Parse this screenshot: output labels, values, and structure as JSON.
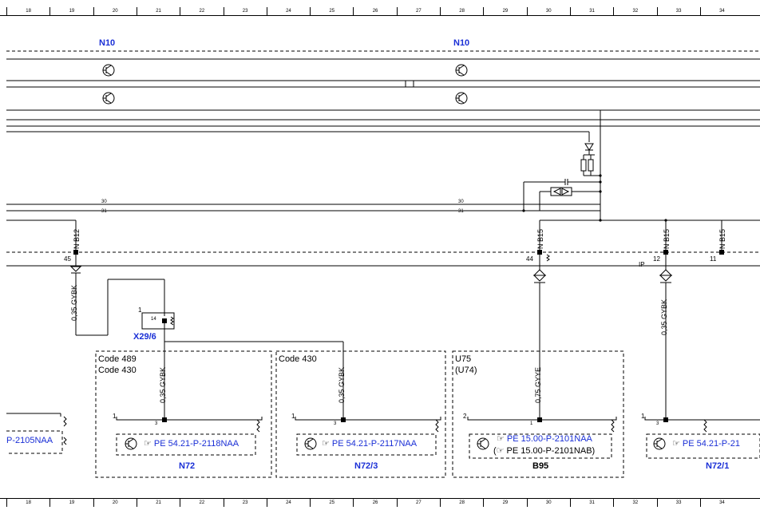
{
  "ruler": [
    "18",
    "19",
    "20",
    "21",
    "22",
    "23",
    "24",
    "25",
    "26",
    "27",
    "28",
    "29",
    "30",
    "31",
    "32",
    "33",
    "34"
  ],
  "components": {
    "n10_left": "N10",
    "n10_right": "N10",
    "x29": "X29/6",
    "n72": "N72",
    "n72_3": "N72/3",
    "b95": "B95",
    "n72_1": "N72/1",
    "u75": "U75",
    "u74": "(U74)"
  },
  "codes": {
    "box1_line1": "Code 489",
    "box1_line2": "Code 430",
    "box2": "Code 430"
  },
  "wires": {
    "w1": "0,35 GYBK",
    "w2": "0,35 GYBK",
    "w3": "0,35 GYBK",
    "w4": "0,75 GYYE",
    "w5": "0,35 GYBK"
  },
  "refs": {
    "left_partial": "P-2105NAA",
    "n72": "PE 54.21-P-2118NAA",
    "n72_3": "PE 54.21-P-2117NAA",
    "b95_a": "PE 15.00-P-2101NAA",
    "b95_b": "PE 15.00-P-2101NAB)",
    "n72_1": "PE 54.21-P-21"
  },
  "pins": {
    "p45": "45",
    "p44": "44",
    "p12": "12",
    "p11": "11",
    "p14": "14",
    "x29_1": "1",
    "n72_1": "1",
    "n72_3": "3",
    "n723_1": "1",
    "n723_3": "3",
    "b95_2": "2",
    "b95_1": "1",
    "n721_1": "1",
    "n721_3": "3",
    "line30a": "30",
    "line31a": "31",
    "line30b": "30",
    "line31b": "31",
    "ip": "IP"
  },
  "splices": {
    "s1": "N B12",
    "s2": "N B15",
    "s3": "N B15",
    "s4": "N B15"
  }
}
